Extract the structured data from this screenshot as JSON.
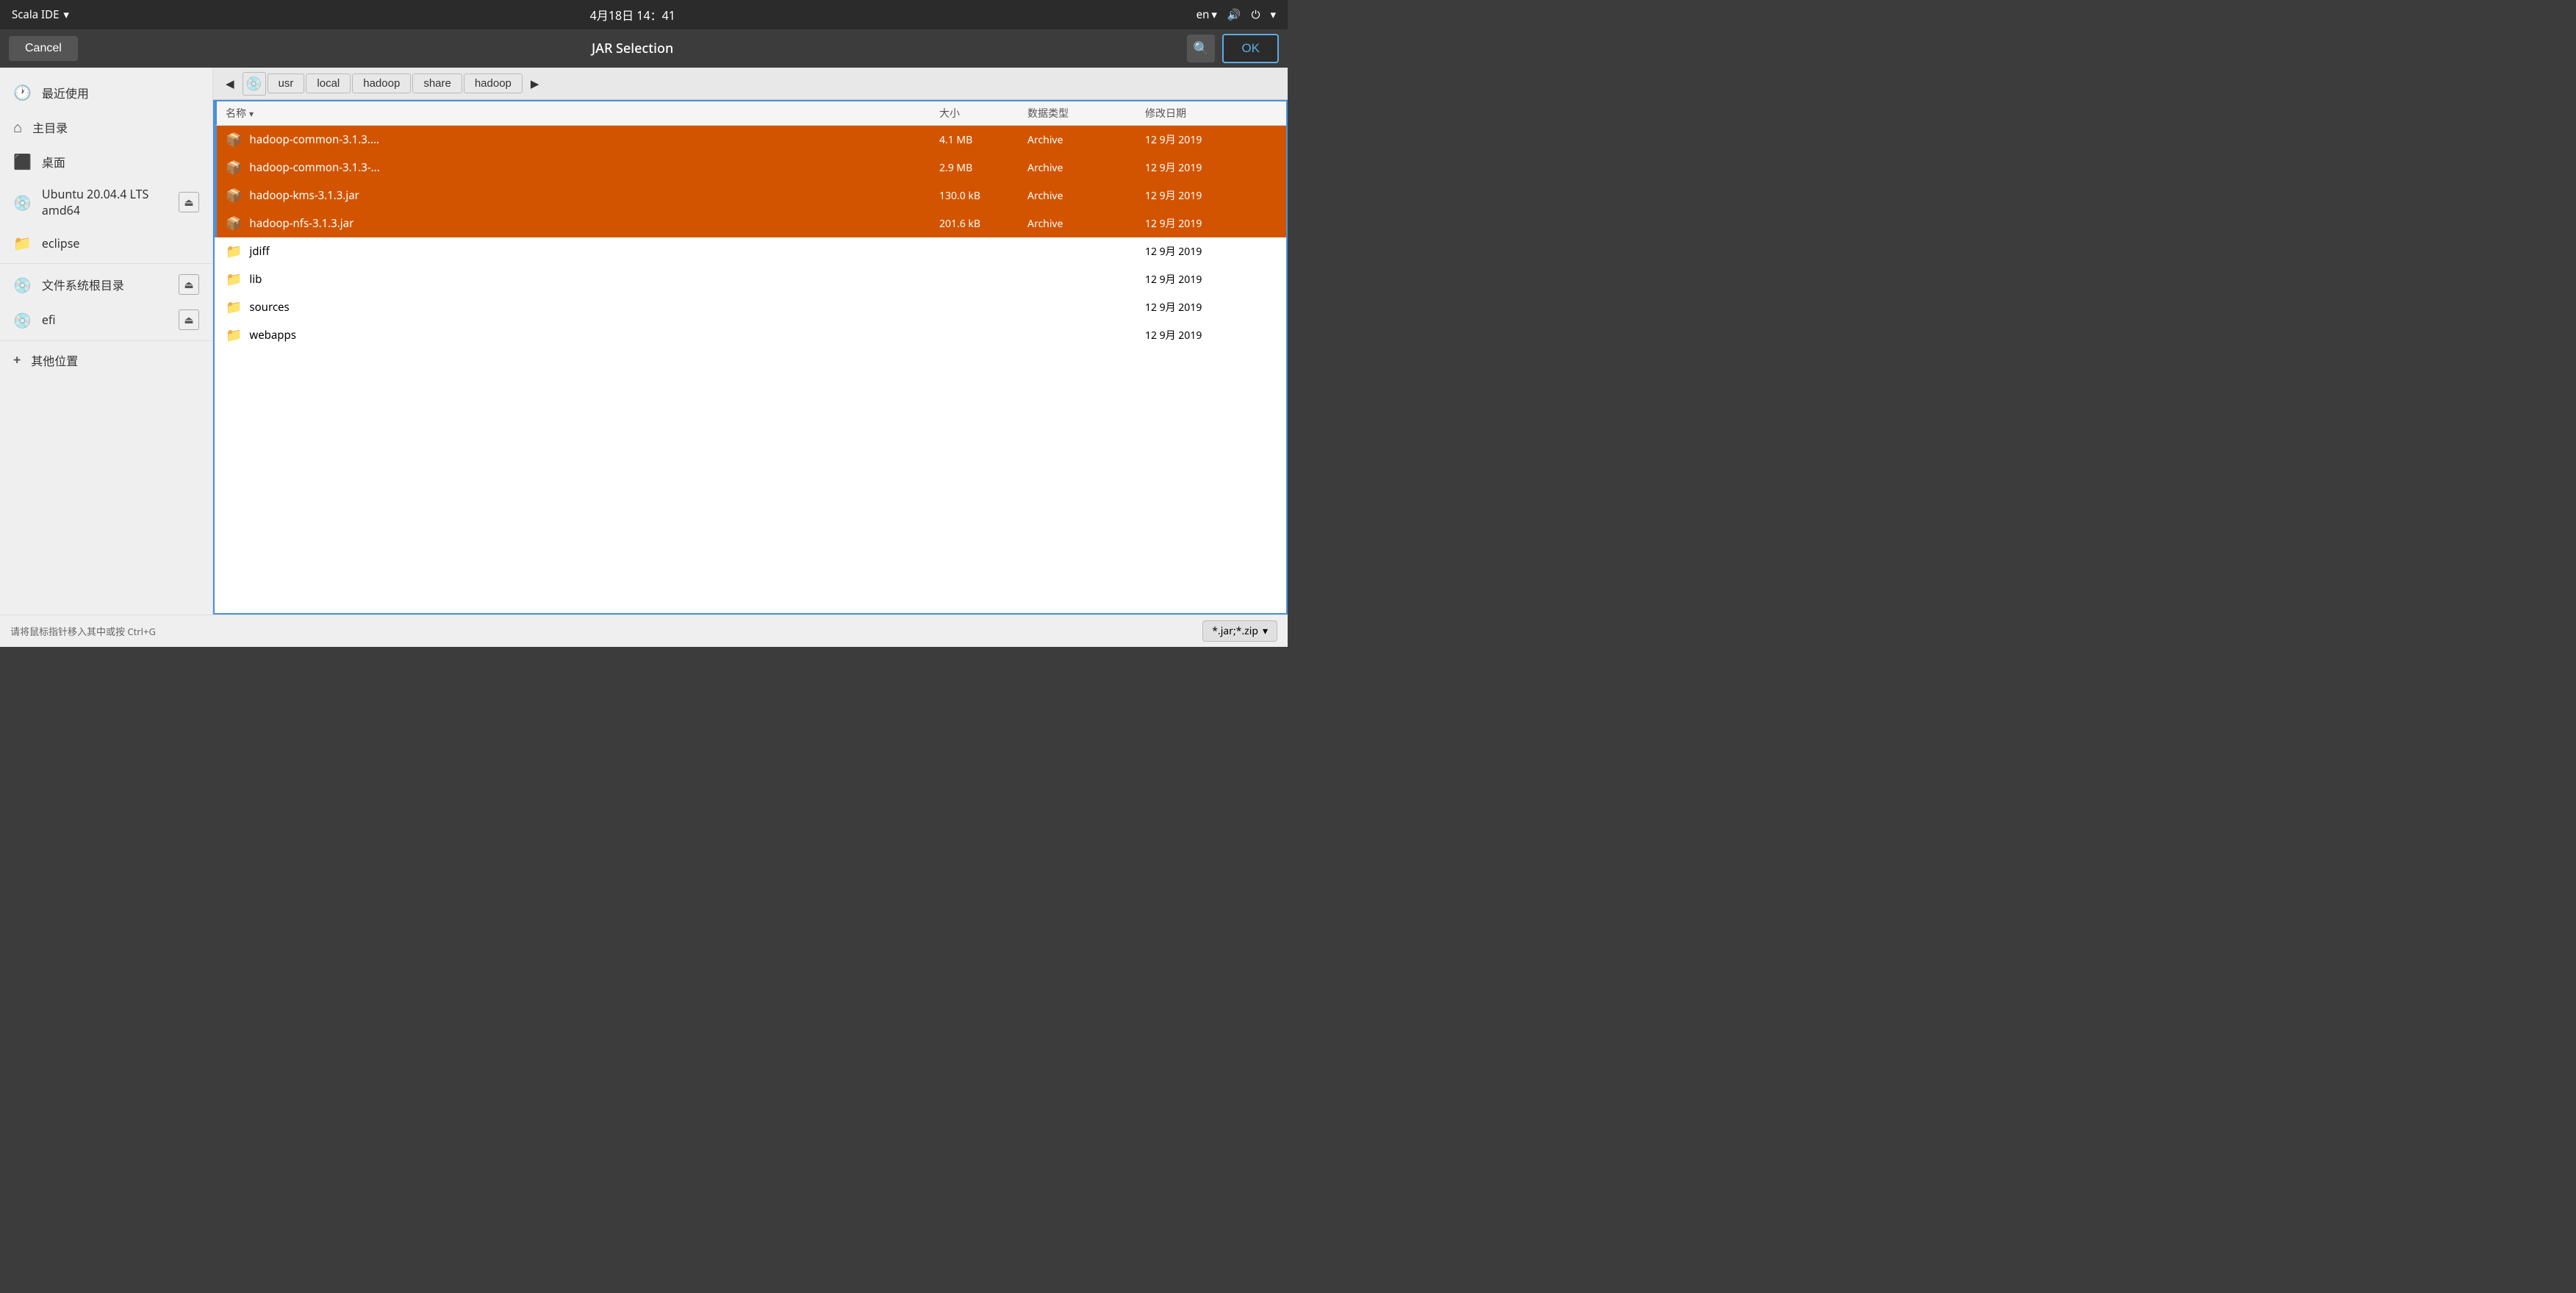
{
  "topbar": {
    "app_name": "Scala IDE",
    "dropdown_arrow": "▾",
    "datetime": "4月18日  14：41",
    "language": "en",
    "lang_arrow": "▾",
    "volume_icon": "🔊",
    "power_icon": "⏻",
    "power_arrow": "▾"
  },
  "dialog": {
    "cancel_label": "Cancel",
    "title": "JAR Selection",
    "ok_label": "OK"
  },
  "sidebar": {
    "items": [
      {
        "id": "recent",
        "icon": "🕐",
        "label": "最近使用",
        "eject": false
      },
      {
        "id": "home",
        "icon": "🏠",
        "label": "主目录",
        "eject": false
      },
      {
        "id": "desktop",
        "icon": "⬛",
        "label": "桌面",
        "eject": false
      },
      {
        "id": "ubuntu",
        "icon": "💿",
        "label": "Ubuntu 20.04.4 LTS amd64",
        "eject": true
      },
      {
        "id": "eclipse",
        "icon": "📁",
        "label": "eclipse",
        "eject": false
      },
      {
        "id": "filesystem",
        "icon": "💿",
        "label": "文件系统根目录",
        "eject": true
      },
      {
        "id": "efi",
        "icon": "💿",
        "label": "efi",
        "eject": true
      },
      {
        "id": "other",
        "icon": "+",
        "label": "其他位置",
        "eject": false
      }
    ]
  },
  "breadcrumb": {
    "back_arrow": "◀",
    "forward_arrow": "▶",
    "drive_icon": "💿",
    "items": [
      "usr",
      "local",
      "hadoop",
      "share",
      "hadoop"
    ]
  },
  "file_list": {
    "columns": {
      "name": "名称",
      "size": "大小",
      "type": "数据类型",
      "date": "修改日期"
    },
    "sort_arrow": "▾",
    "files": [
      {
        "id": "f1",
        "name": "hadoop-common-3.1.3....",
        "icon_type": "jar",
        "size": "4.1 MB",
        "type": "Archive",
        "date": "12 9月 2019",
        "selected": true
      },
      {
        "id": "f2",
        "name": "hadoop-common-3.1.3-...",
        "icon_type": "jar",
        "size": "2.9 MB",
        "type": "Archive",
        "date": "12 9月 2019",
        "selected": true
      },
      {
        "id": "f3",
        "name": "hadoop-kms-3.1.3.jar",
        "icon_type": "jar",
        "size": "130.0 kB",
        "type": "Archive",
        "date": "12 9月 2019",
        "selected": true
      },
      {
        "id": "f4",
        "name": "hadoop-nfs-3.1.3.jar",
        "icon_type": "jar",
        "size": "201.6 kB",
        "type": "Archive",
        "date": "12 9月 2019",
        "selected": true
      },
      {
        "id": "f5",
        "name": "jdiff",
        "icon_type": "folder",
        "size": "",
        "type": "",
        "date": "12 9月 2019",
        "selected": false
      },
      {
        "id": "f6",
        "name": "lib",
        "icon_type": "folder",
        "size": "",
        "type": "",
        "date": "12 9月 2019",
        "selected": false
      },
      {
        "id": "f7",
        "name": "sources",
        "icon_type": "folder",
        "size": "",
        "type": "",
        "date": "12 9月 2019",
        "selected": false
      },
      {
        "id": "f8",
        "name": "webapps",
        "icon_type": "folder",
        "size": "",
        "type": "",
        "date": "12 9月 2019",
        "selected": false
      }
    ]
  },
  "bottom": {
    "status_text": "请将鼠标指针移入其中或按 Ctrl+G",
    "filter_label": "*.jar;*.zip",
    "filter_arrow": "▾"
  },
  "icons": {
    "jar": "📦",
    "folder": "📁",
    "search": "🔍",
    "clock": "🕐",
    "home": "⌂",
    "drive": "💿",
    "eject": "⏏"
  }
}
